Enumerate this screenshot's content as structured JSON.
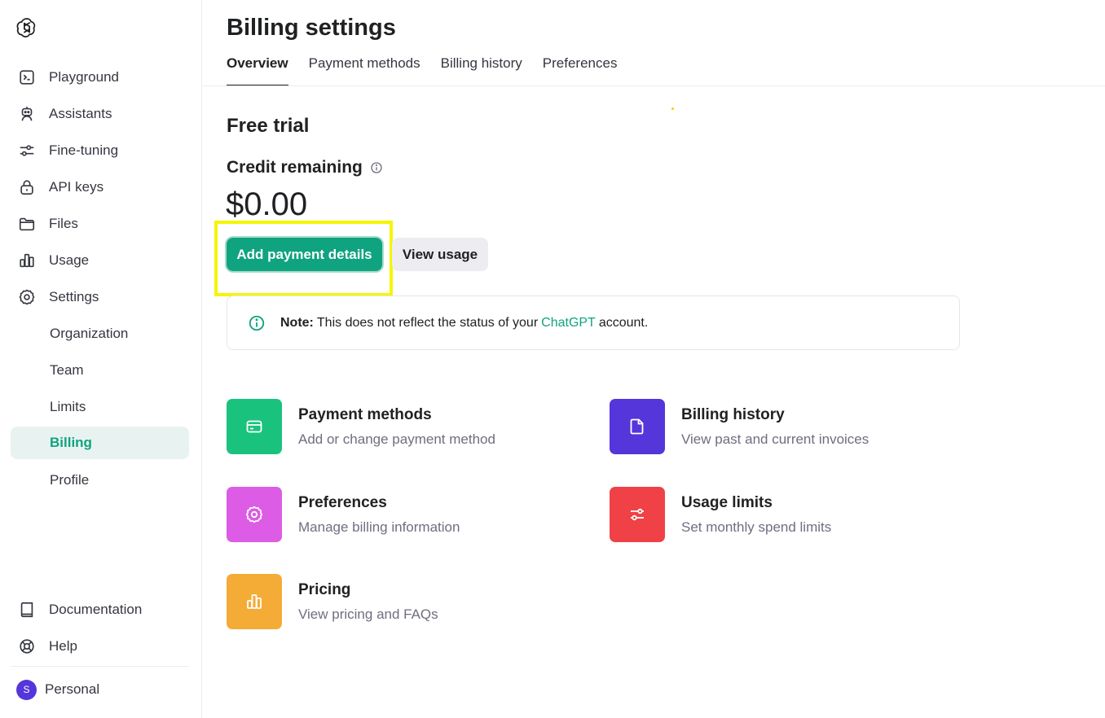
{
  "sidebar": {
    "logo": "openai-logo-icon",
    "items": [
      {
        "label": "Playground",
        "icon": "terminal-icon"
      },
      {
        "label": "Assistants",
        "icon": "robot-icon"
      },
      {
        "label": "Fine-tuning",
        "icon": "sliders-icon"
      },
      {
        "label": "API keys",
        "icon": "lock-icon"
      },
      {
        "label": "Files",
        "icon": "folder-icon"
      },
      {
        "label": "Usage",
        "icon": "bar-chart-icon"
      },
      {
        "label": "Settings",
        "icon": "gear-icon"
      }
    ],
    "settings_sub": [
      {
        "label": "Organization"
      },
      {
        "label": "Team"
      },
      {
        "label": "Limits"
      },
      {
        "label": "Billing",
        "active": true
      },
      {
        "label": "Profile"
      }
    ],
    "bottom": [
      {
        "label": "Documentation",
        "icon": "book-icon"
      },
      {
        "label": "Help",
        "icon": "lifebuoy-icon"
      }
    ],
    "account": {
      "initial": "S",
      "label": "Personal",
      "color": "#5436da"
    }
  },
  "header": {
    "title": "Billing settings",
    "tabs": [
      {
        "label": "Overview",
        "active": true
      },
      {
        "label": "Payment methods"
      },
      {
        "label": "Billing history"
      },
      {
        "label": "Preferences"
      }
    ]
  },
  "main": {
    "plan_title": "Free trial",
    "credit_label": "Credit remaining",
    "credit_value": "$0.00",
    "primary_button": "Add payment details",
    "secondary_button": "View usage",
    "note": {
      "bold": "Note:",
      "text_before": "This does not reflect the status of your",
      "link": "ChatGPT",
      "text_after": "account."
    },
    "cards": [
      {
        "title": "Payment methods",
        "desc": "Add or change payment method",
        "color": "#19c37d",
        "icon": "credit-card-icon"
      },
      {
        "title": "Billing history",
        "desc": "View past and current invoices",
        "color": "#5436da",
        "icon": "document-icon"
      },
      {
        "title": "Preferences",
        "desc": "Manage billing information",
        "color": "#dd5ce5",
        "icon": "gear-icon"
      },
      {
        "title": "Usage limits",
        "desc": "Set monthly spend limits",
        "color": "#ef4146",
        "icon": "sliders-icon"
      },
      {
        "title": "Pricing",
        "desc": "View pricing and FAQs",
        "color": "#f4ac36",
        "icon": "bar-chart-icon"
      }
    ]
  },
  "colors": {
    "accent": "#10a37f",
    "highlight": "#f5f500"
  }
}
